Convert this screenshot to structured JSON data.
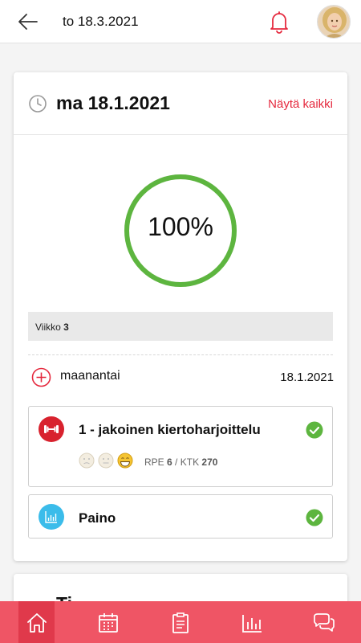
{
  "header": {
    "date": "to 18.3.2021"
  },
  "day_card": {
    "date": "ma 18.1.2021",
    "show_all": "Näytä kaikki",
    "progress_label": "100%",
    "progress_value": 1.0,
    "week_prefix": "Viikko",
    "week_number": "3",
    "day_name": "maanantai",
    "day_date": "18.1.2021",
    "items": [
      {
        "title": "1 - jakoinen kiertoharjoittelu",
        "rpe_label": "RPE",
        "rpe": "6",
        "ktk_label": "KTK",
        "ktk": "270",
        "icon": "dumbbell-icon",
        "done": true
      },
      {
        "title": "Paino",
        "icon": "chart-icon",
        "done": true
      }
    ]
  },
  "next_card": {
    "title": "Ti"
  },
  "colors": {
    "accent": "#e5293e",
    "success": "#5db53f",
    "nav": "#ef5565"
  },
  "nav": [
    "home-icon",
    "calendar-icon",
    "clipboard-icon",
    "stats-icon",
    "chat-icon"
  ]
}
